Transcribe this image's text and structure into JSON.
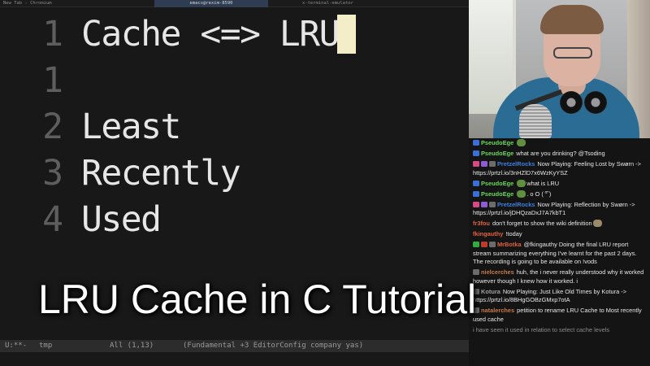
{
  "topbar": {
    "left": "New Tab - Chromium",
    "center": "emacs@rexim-8590",
    "right": "x-terminal-emulator"
  },
  "editor": {
    "lines": [
      {
        "number": "1",
        "text": "Cache <=> LRU"
      },
      {
        "number": "1",
        "text": ""
      },
      {
        "number": "2",
        "text": "Least"
      },
      {
        "number": "3",
        "text": "Recently"
      },
      {
        "number": "4",
        "text": "Used"
      }
    ],
    "modeline": {
      "status": "U:**-",
      "buffer": "tmp",
      "position": "All (1,13)",
      "modes": "(Fundamental +3 EditorConfig company yas)"
    }
  },
  "chat": {
    "colors": {
      "PseudoEge": "#6bd85a",
      "PretzelRocks": "#3f7fe0",
      "fr3fou": "#e0623f",
      "fkingauthy": "#e0623f",
      "MrBotka": "#e0623f",
      "nielcerches": "#c77a4a",
      "Kotura": "#a0a0a0",
      "natalerches": "#c77a4a"
    },
    "messages": [
      {
        "user": "PseudoEge",
        "text": "",
        "emote": "frog"
      },
      {
        "user": "PseudoEge",
        "text": "what are you drinking? @Tsoding"
      },
      {
        "user": "PretzelRocks",
        "text": "Now Playing: Feeling Lost by Swørn -> https://prtzl.io/3nHZlD7x6WzKyYSZ"
      },
      {
        "user": "PseudoEge",
        "text": "what is LRU",
        "emote": "frog"
      },
      {
        "user": "PseudoEge",
        "text": ". o O (  ͡° )",
        "emote": "frog"
      },
      {
        "user": "PretzelRocks",
        "text": "Now Playing: Reflection by Swørn -> https://prtzl.io/jDHQzaDxJ7A7kbT1"
      },
      {
        "user": "fr3fou",
        "text": "don't forget to show the wiki definition"
      },
      {
        "user": "fkingauthy",
        "text": "!today"
      },
      {
        "user": "MrBotka",
        "text": "@fkingauthy Doing the final LRU report stream summarizing everything I've learnt for the past 2 days. The recording is going to be available on !vods"
      },
      {
        "user": "nielcerches",
        "text": "huh, the i never really understood why it worked however though I knew how it worked. i"
      },
      {
        "user": "Kotura",
        "text": "Now Playing: Just Like Old Times by Kotura -> https://prtzl.io/8BHgGOBzGMxp7otA"
      },
      {
        "user": "natalerches",
        "text": "petition to rename LRU Cache to Most recently used cache"
      },
      {
        "user": "",
        "text": "i have seen it used in relation to select cache levels"
      }
    ]
  },
  "overlay": {
    "title": "LRU Cache in C Tutorial"
  }
}
